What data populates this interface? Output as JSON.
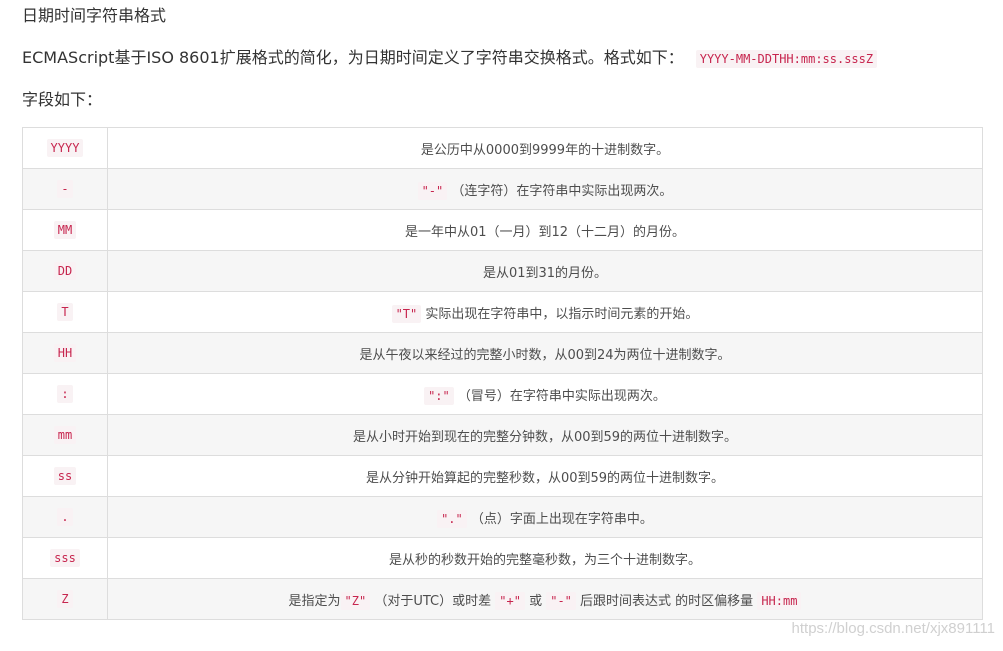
{
  "title": "日期时间字符串格式",
  "intro": {
    "text": "ECMAScript基于ISO 8601扩展格式的简化，为日期时间定义了字符串交换格式。格式如下：",
    "format": "YYYY-MM-DDTHH:mm:ss.sssZ"
  },
  "fields_label": "字段如下：",
  "rows": [
    {
      "key": "YYYY",
      "desc": [
        {
          "t": "是公历中从0000到9999年的十进制数字。"
        }
      ]
    },
    {
      "key": "-",
      "desc": [
        {
          "c": "\"-\""
        },
        {
          "t": " （连字符）在字符串中实际出现两次。"
        }
      ]
    },
    {
      "key": "MM",
      "desc": [
        {
          "t": "是一年中从01（一月）到12（十二月）的月份。"
        }
      ]
    },
    {
      "key": "DD",
      "desc": [
        {
          "t": "是从01到31的月份。"
        }
      ]
    },
    {
      "key": "T",
      "desc": [
        {
          "c": "\"T\""
        },
        {
          "t": " 实际出现在字符串中，以指示时间元素的开始。"
        }
      ]
    },
    {
      "key": "HH",
      "desc": [
        {
          "t": "是从午夜以来经过的完整小时数，从00到24为两位十进制数字。"
        }
      ]
    },
    {
      "key": ":",
      "desc": [
        {
          "c": "\":\""
        },
        {
          "t": " （冒号）在字符串中实际出现两次。"
        }
      ]
    },
    {
      "key": "mm",
      "desc": [
        {
          "t": "是从小时开始到现在的完整分钟数，从00到59的两位十进制数字。"
        }
      ]
    },
    {
      "key": "ss",
      "desc": [
        {
          "t": "是从分钟开始算起的完整秒数，从00到59的两位十进制数字。"
        }
      ]
    },
    {
      "key": ".",
      "desc": [
        {
          "c": "\".\""
        },
        {
          "t": " （点）字面上出现在字符串中。"
        }
      ]
    },
    {
      "key": "sss",
      "desc": [
        {
          "t": "是从秒的秒数开始的完整毫秒数，为三个十进制数字。"
        }
      ]
    },
    {
      "key": "Z",
      "desc": [
        {
          "t": "是指定为"
        },
        {
          "c": "\"Z\""
        },
        {
          "t": " （对于UTC）或时差 "
        },
        {
          "c": "\"+\""
        },
        {
          "t": " 或 "
        },
        {
          "c": "\"-\""
        },
        {
          "t": " 后跟时间表达式 的时区偏移量 "
        },
        {
          "c": "HH:mm"
        }
      ]
    }
  ],
  "watermark": "https://blog.csdn.net/xjx891111"
}
